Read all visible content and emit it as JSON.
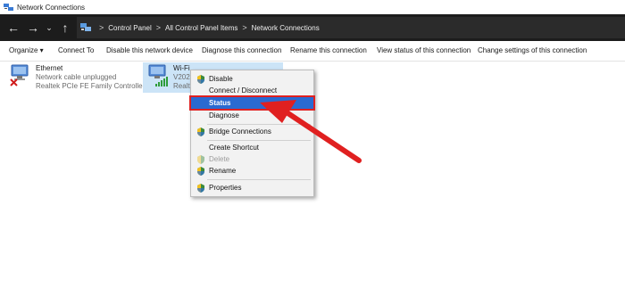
{
  "window": {
    "title": "Network Connections"
  },
  "nav": {
    "back": "←",
    "forward": "→",
    "recent": "⌄",
    "up": "↑"
  },
  "breadcrumb": {
    "separator": ">",
    "items": [
      "Control Panel",
      "All Control Panel Items",
      "Network Connections"
    ]
  },
  "toolbar": {
    "organize": "Organize ▾",
    "connect_to": "Connect To",
    "disable_device": "Disable this network device",
    "diagnose": "Diagnose this connection",
    "rename": "Rename this connection",
    "view_status": "View status of this connection",
    "change_settings": "Change settings of this connection"
  },
  "connections": [
    {
      "name": "Ethernet",
      "status": "Network cable unplugged",
      "device": "Realtek PCIe FE Family Controller"
    },
    {
      "name": "Wi-Fi",
      "status": "V202",
      "device": "Realt"
    }
  ],
  "context_menu": {
    "items": [
      {
        "label": "Disable",
        "shield": true,
        "disabled": false
      },
      {
        "label": "Connect / Disconnect",
        "shield": false,
        "disabled": false
      },
      {
        "label": "Status",
        "shield": false,
        "disabled": false,
        "highlighted": true
      },
      {
        "label": "Diagnose",
        "shield": false,
        "disabled": false
      },
      {
        "label": "Bridge Connections",
        "shield": true,
        "disabled": false
      },
      {
        "label": "Create Shortcut",
        "shield": false,
        "disabled": false
      },
      {
        "label": "Delete",
        "shield": true,
        "disabled": true
      },
      {
        "label": "Rename",
        "shield": true,
        "disabled": false
      },
      {
        "label": "Properties",
        "shield": true,
        "disabled": false
      }
    ]
  },
  "colors": {
    "navbar": "#1c1c1c",
    "selection": "#cce4f7",
    "menu_highlight": "#2a6ad1",
    "annotation_red": "#e02020"
  }
}
